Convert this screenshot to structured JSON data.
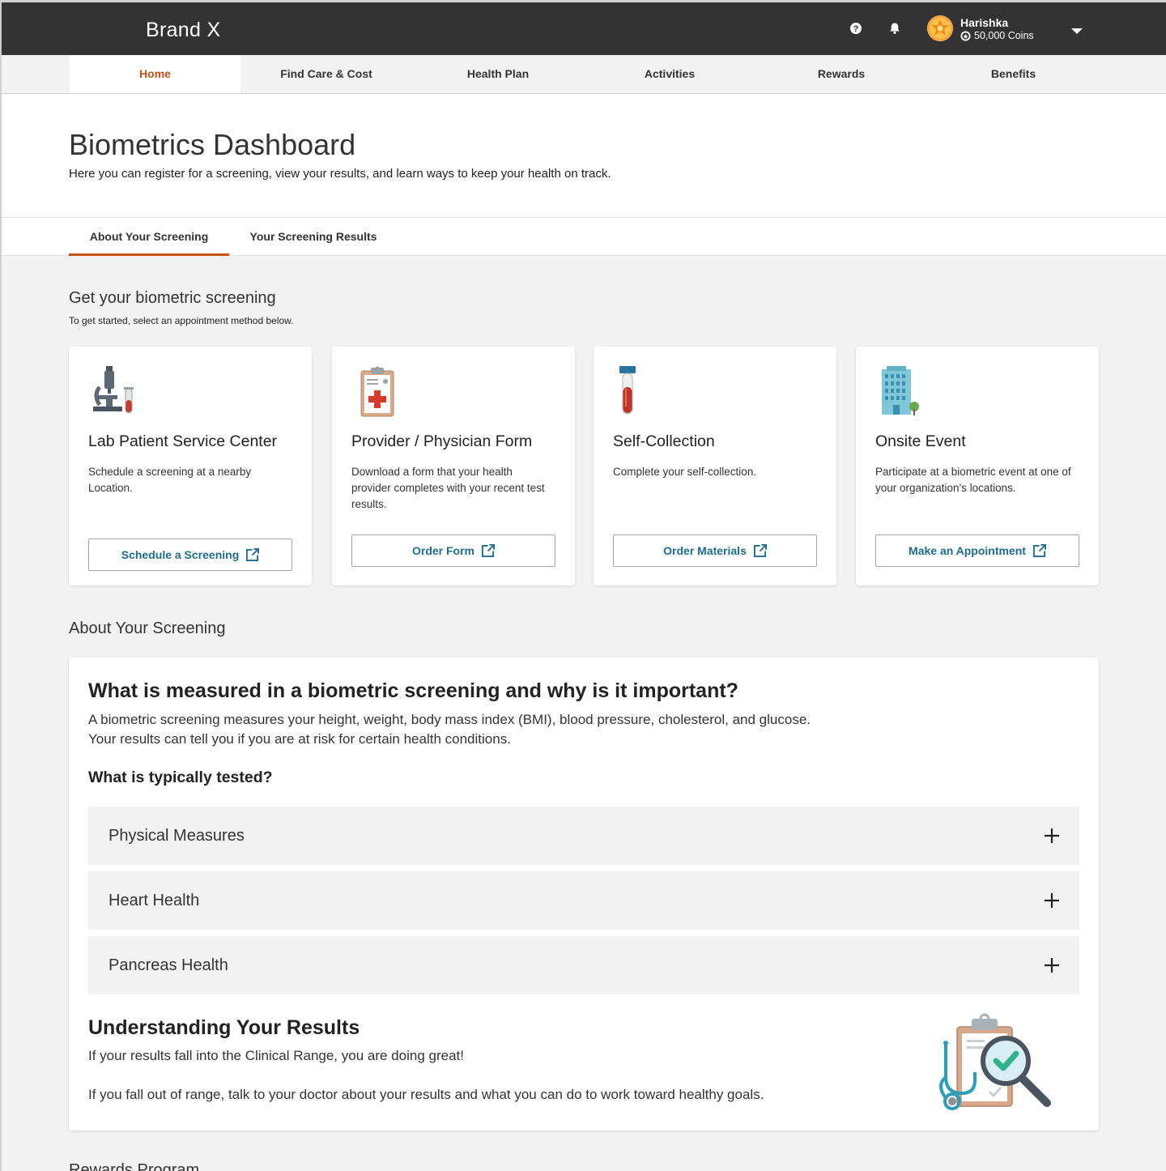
{
  "app": {
    "brand": "Brand X"
  },
  "user": {
    "name": "Harishka",
    "coins": "50,000 Coins"
  },
  "nav": {
    "items": [
      {
        "label": "Home",
        "active": true
      },
      {
        "label": "Find Care & Cost"
      },
      {
        "label": "Health Plan"
      },
      {
        "label": "Activities"
      },
      {
        "label": "Rewards"
      },
      {
        "label": "Benefits"
      }
    ]
  },
  "header": {
    "title": "Biometrics Dashboard",
    "subtitle": "Here you can register for a screening, view your results, and learn ways to keep your health on track."
  },
  "subtabs": [
    {
      "label": "About Your Screening",
      "active": true
    },
    {
      "label": "Your Screening Results"
    }
  ],
  "get_screening": {
    "title": "Get your biometric screening",
    "subtitle": "To get started, select an appointment method below."
  },
  "cards": [
    {
      "title": "Lab Patient Service Center",
      "desc": "Schedule a screening at a nearby Location.",
      "button": "Schedule a Screening",
      "icon": "microscope-icon"
    },
    {
      "title": "Provider / Physician Form",
      "desc": "Download a form that your health provider completes with your recent test results.",
      "button": "Order Form",
      "icon": "clipboard-form-icon"
    },
    {
      "title": "Self-Collection",
      "desc": "Complete your self-collection.",
      "button": "Order Materials",
      "icon": "test-tube-icon"
    },
    {
      "title": "Onsite Event",
      "desc": "Participate at a biometric event at one of your organization's locations.",
      "button": "Make an Appointment",
      "icon": "building-icon"
    }
  ],
  "about": {
    "section_title": "About Your Screening",
    "heading": "What is measured in a biometric screening and why is it important?",
    "paragraph": "A biometric screening measures your height, weight, body mass index (BMI), blood pressure, cholesterol, and glucose. Your results can tell you if you are at risk for certain health conditions.",
    "tested_heading": "What is typically tested?",
    "accordion": [
      "Physical Measures",
      "Heart Health",
      "Pancreas Health"
    ],
    "understanding": {
      "title": "Understanding Your Results",
      "p1": "If your results fall into the Clinical Range, you are doing great!",
      "p2": "If you fall out of range, talk to your doctor about your results and what you can do to work toward healthy goals."
    }
  },
  "rewards": {
    "title": "Rewards Program"
  },
  "colors": {
    "topbar": "#333333",
    "accent": "#c4501a",
    "link": "#1e6d8c",
    "page_bg": "#f2f2f2"
  }
}
